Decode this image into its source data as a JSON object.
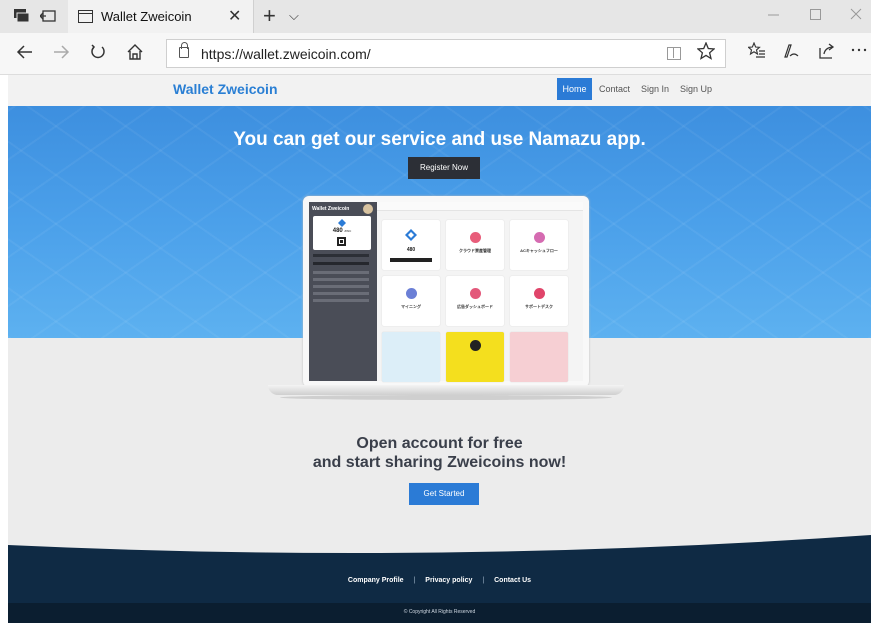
{
  "browser": {
    "tab_title": "Wallet Zweicoin",
    "tab_close": "✕",
    "new_tab": "+",
    "tab_menu": "⌵",
    "url": "https://wallet.zweicoin.com/",
    "icons": [
      "tab-list-icon",
      "set-aside-tabs-icon",
      "back-icon",
      "forward-icon",
      "refresh-icon",
      "home-icon",
      "lock-icon",
      "reading-view-icon",
      "favorite-star-icon",
      "favorites-list-icon",
      "pen-icon",
      "share-icon",
      "more-icon"
    ]
  },
  "site": {
    "brand": "Wallet Zweicoin",
    "nav": {
      "home": "Home",
      "contact": "Contact",
      "sign_in": "Sign In",
      "sign_up": "Sign Up"
    },
    "hero": {
      "title": "You can get our service and use Namazu app.",
      "register_button": "Register Now"
    },
    "app_preview": {
      "sidebar_title": "Wallet Zweicoin",
      "balance": "480",
      "balance_unit": "ZWC",
      "card_labels": [
        "クラウド資産管理",
        "ACキャッシュフロー",
        "マイニング",
        "広告ダッシュボード",
        "サポートデスク"
      ]
    },
    "cta": {
      "line1": "Open account for free",
      "line2": "and start sharing Zweicoins now!",
      "button": "Get Started"
    },
    "footer": {
      "links": [
        "Company Profile",
        "Privacy policy",
        "Contact Us"
      ],
      "copyright": "© Copyright All Rights Reserved"
    }
  },
  "colors": {
    "accent": "#2b7bd6",
    "hero_blue": "#4ba0ea",
    "footer_navy": "#0f2a44",
    "dark_button": "#2c2f36"
  }
}
